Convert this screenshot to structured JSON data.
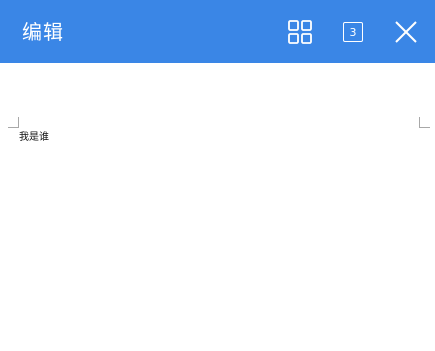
{
  "header": {
    "title": "编辑",
    "page_count": "3",
    "icons": {
      "grid": "grid-icon",
      "count": "page-count-icon",
      "close": "close-icon"
    },
    "colors": {
      "bar": "#3a86e6",
      "foreground": "#ffffff"
    }
  },
  "document": {
    "text": "我是谁"
  }
}
